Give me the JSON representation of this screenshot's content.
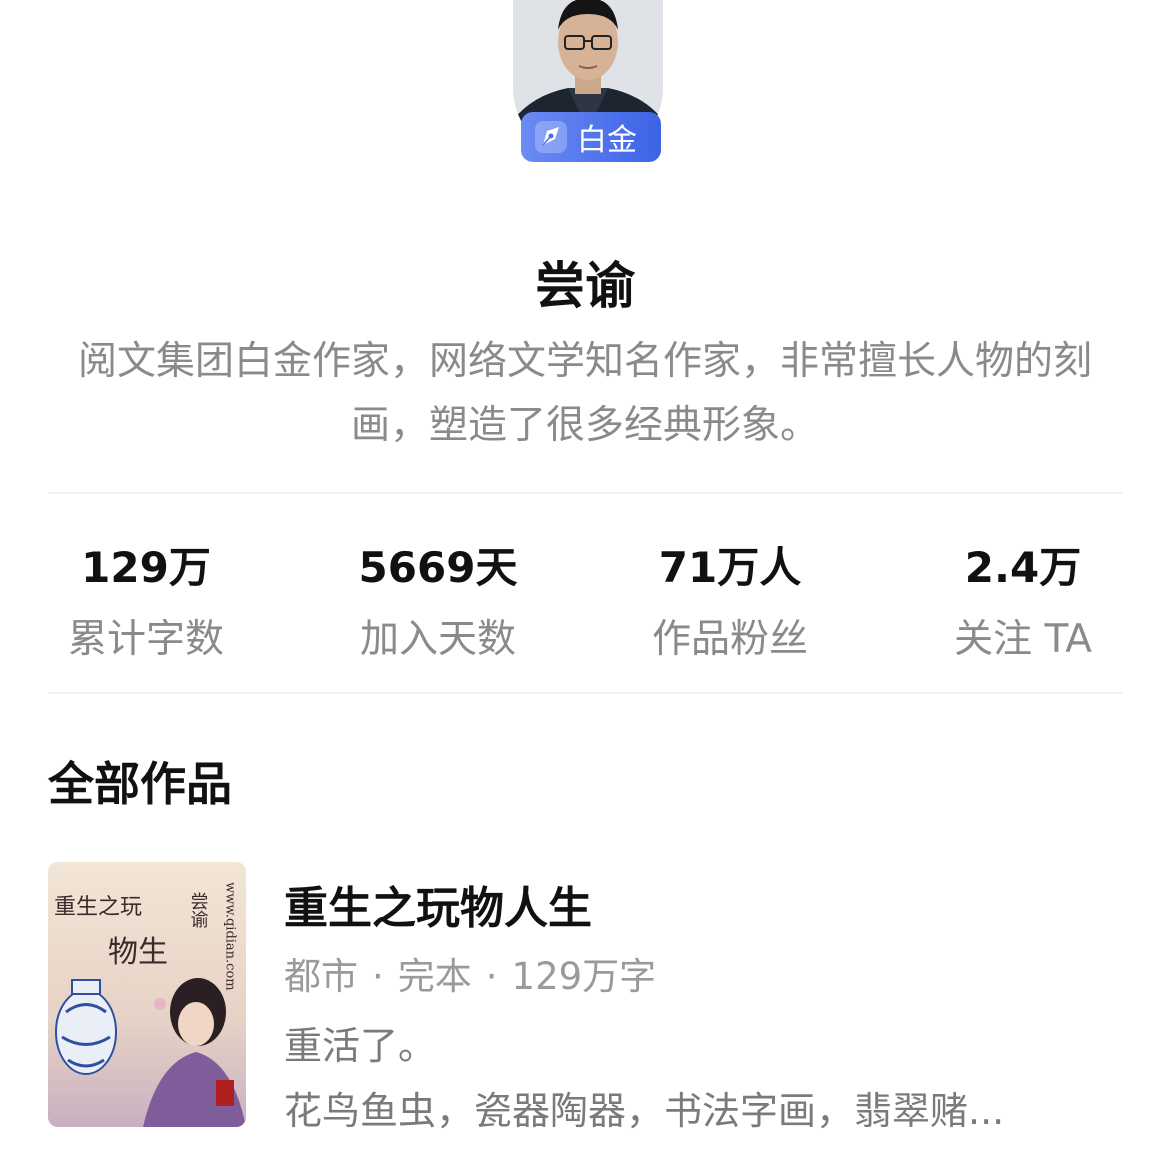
{
  "author": {
    "name": "尝谕",
    "level_badge": "白金",
    "badge_icon": "pen-nib-icon",
    "bio": "阅文集团白金作家，网络文学知名作家，非常擅长人物的刻画，塑造了很多经典形象。"
  },
  "stats": [
    {
      "value": "129万",
      "label": "累计字数"
    },
    {
      "value": "5669天",
      "label": "加入天数"
    },
    {
      "value": "71万人",
      "label": "作品粉丝"
    },
    {
      "value": "2.4万",
      "label": "关注 TA"
    }
  ],
  "works": {
    "section_title": "全部作品",
    "items": [
      {
        "title": "重生之玩物人生",
        "category": "都市",
        "status": "完本",
        "word_count": "129万字",
        "separator": "·",
        "intro": "重活了。",
        "tags": "花鸟鱼虫，瓷器陶器，书法字画，翡翠赌...",
        "cover": {
          "title_art": "重生之玩人物生",
          "author_art": "尝谕",
          "site_art": "www.qidian.com"
        }
      }
    ]
  },
  "colors": {
    "badge_start": "#6b8bf4",
    "badge_end": "#3d63e6",
    "primary_text": "#111111",
    "secondary_text": "#8a8a8a",
    "divider": "#efefef"
  }
}
